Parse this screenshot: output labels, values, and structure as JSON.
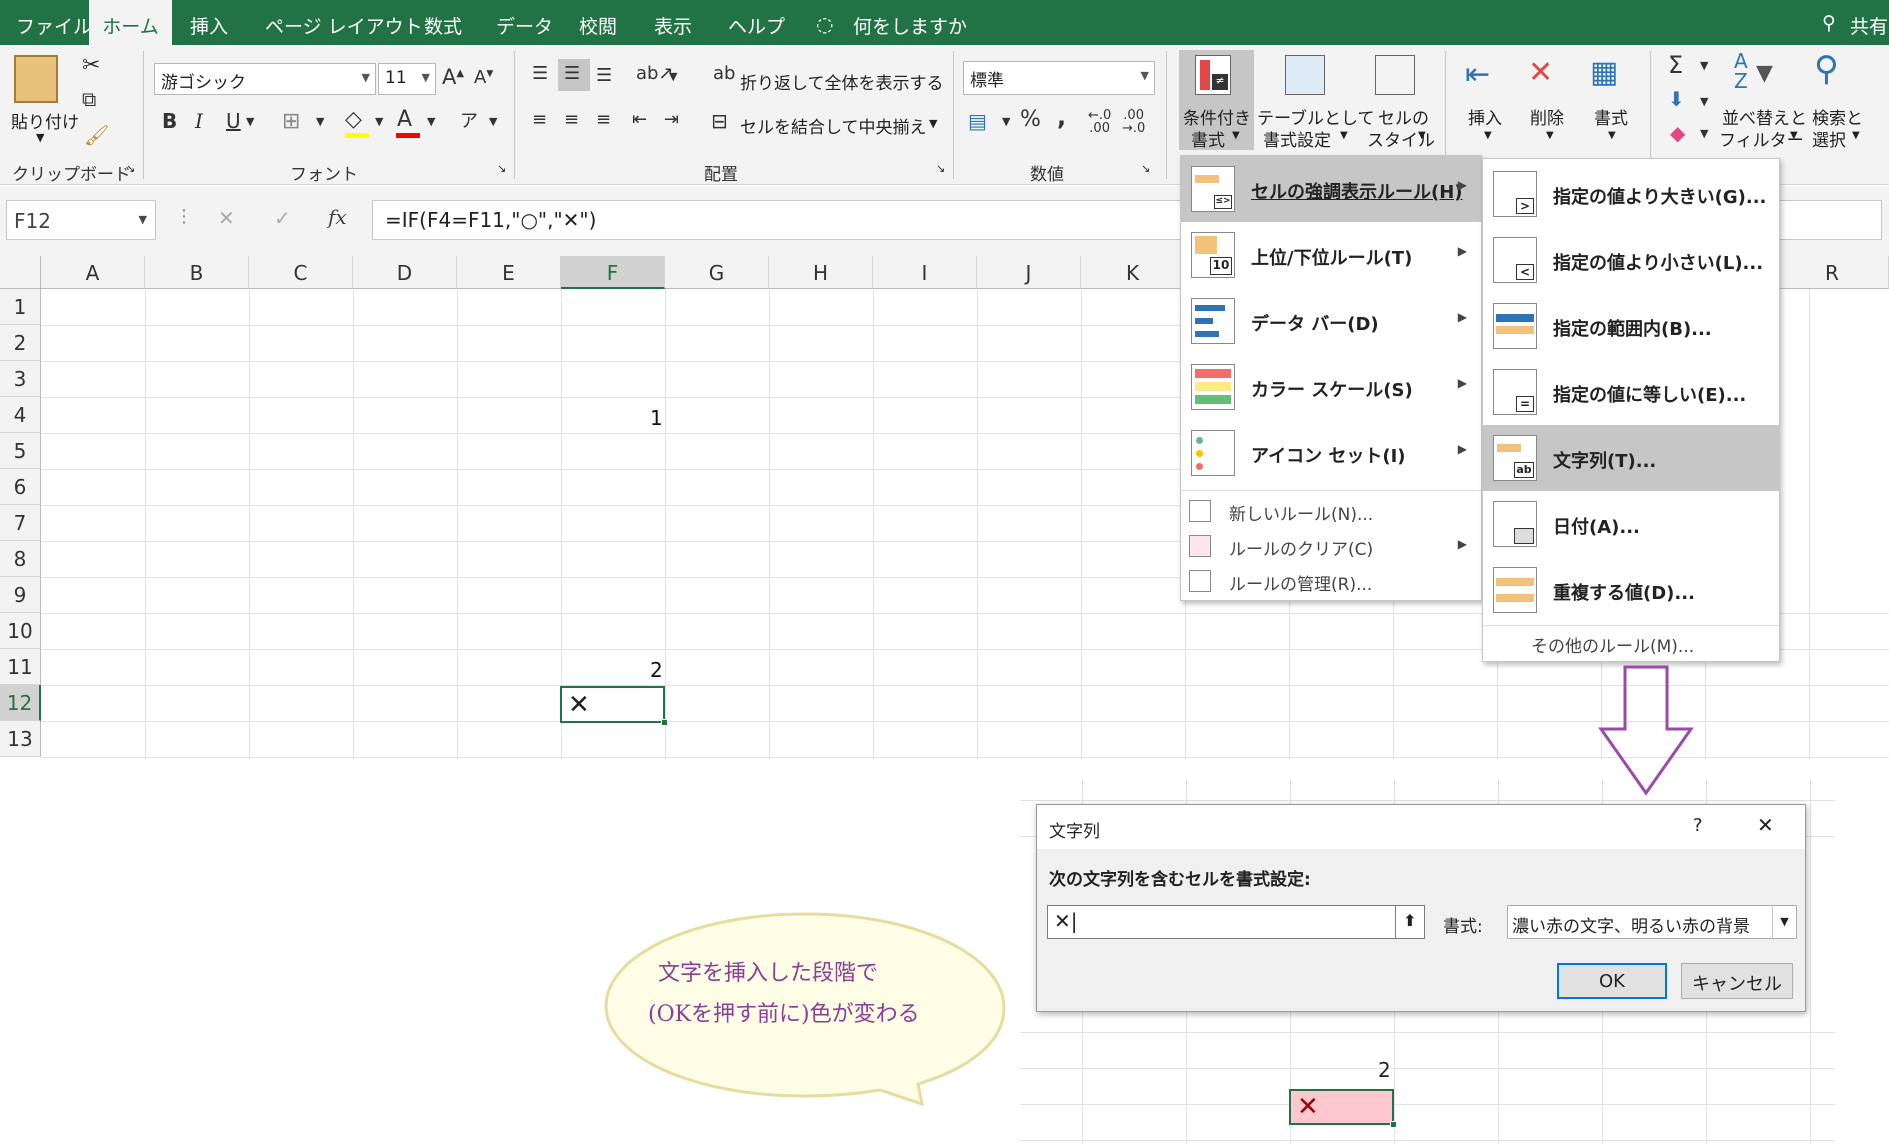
{
  "menubar": {
    "items": [
      "ファイル",
      "ホーム",
      "挿入",
      "ページ レイアウト",
      "数式",
      "データ",
      "校閲",
      "表示",
      "ヘルプ"
    ],
    "tell_me": "何をしますか",
    "share": "共有"
  },
  "ribbon": {
    "clipboard": {
      "paste": "貼り付け",
      "label": "クリップボード"
    },
    "font": {
      "name": "游ゴシック",
      "size": "11",
      "label": "フォント"
    },
    "alignment": {
      "wrap": "折り返して全体を表示する",
      "merge": "セルを結合して中央揃え",
      "label": "配置"
    },
    "number": {
      "format": "標準",
      "label": "数値"
    },
    "styles": {
      "conditional": "条件付き",
      "conditional2": "書式",
      "table": "テーブルとして",
      "table2": "書式設定",
      "cell": "セルの",
      "cell2": "スタイル"
    },
    "cells": {
      "insert": "挿入",
      "delete": "削除",
      "format": "書式"
    },
    "editing": {
      "sort": "並べ替えと",
      "sort2": "フィルター",
      "find": "検索と",
      "find2": "選択"
    }
  },
  "formula_bar": {
    "name_box": "F12",
    "formula": "=IF(F4=F11,\"○\",\"✕\")",
    "fx": "fx"
  },
  "columns": [
    "A",
    "B",
    "C",
    "D",
    "E",
    "F",
    "G",
    "H",
    "I",
    "J",
    "K",
    "R"
  ],
  "rows": [
    "1",
    "2",
    "3",
    "4",
    "5",
    "6",
    "7",
    "8",
    "9",
    "10",
    "11",
    "12",
    "13"
  ],
  "cells": {
    "f4": "1",
    "f11": "2",
    "f12": "✕"
  },
  "cf_menu": {
    "items": [
      {
        "label": "セルの強調表示ルール(H)"
      },
      {
        "label": "上位/下位ルール(T)"
      },
      {
        "label": "データ バー(D)"
      },
      {
        "label": "カラー スケール(S)"
      },
      {
        "label": "アイコン セット(I)"
      }
    ],
    "small": [
      {
        "label": "新しいルール(N)..."
      },
      {
        "label": "ルールのクリア(C)"
      },
      {
        "label": "ルールの管理(R)..."
      }
    ]
  },
  "highlight_submenu": {
    "items": [
      {
        "label": "指定の値より大きい(G)..."
      },
      {
        "label": "指定の値より小さい(L)..."
      },
      {
        "label": "指定の範囲内(B)..."
      },
      {
        "label": "指定の値に等しい(E)..."
      },
      {
        "label": "文字列(T)..."
      },
      {
        "label": "日付(A)..."
      },
      {
        "label": "重複する値(D)..."
      }
    ],
    "more": "その他のルール(M)..."
  },
  "dialog": {
    "title": "文字列",
    "help": "?",
    "close": "✕",
    "prompt": "次の文字列を含むセルを書式設定:",
    "input": "✕",
    "format_label": "書式:",
    "format_value": "濃い赤の文字、明るい赤の背景",
    "ok": "OK",
    "cancel": "キャンセル"
  },
  "preview": {
    "value": "2",
    "result": "✕"
  },
  "bubble": {
    "line1": "文字を挿入した段階で",
    "line2": "(OKを押す前に)色が変わる"
  },
  "colors": {
    "excel_green": "#217346",
    "highlight_fill": "#ffc7ce",
    "highlight_text": "#9c0006",
    "bubble_fill": "#fefde6",
    "bubble_border": "#e6dca0",
    "arrow": "#9b4aa8"
  }
}
